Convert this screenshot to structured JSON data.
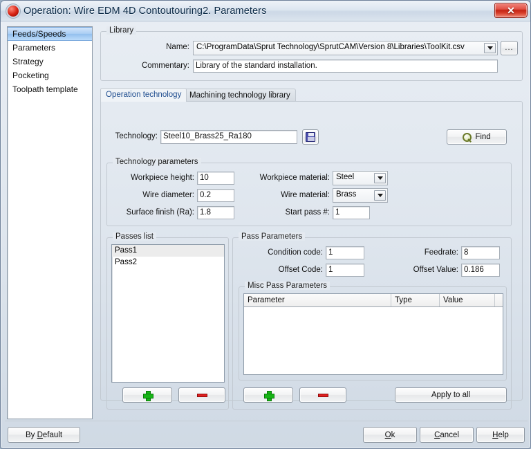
{
  "window": {
    "title": "Operation: Wire EDM 4D Contoutouring2. Parameters",
    "app_icon": "red-sphere-icon",
    "close_label": "✕"
  },
  "sidebar": {
    "items": [
      {
        "label": "Feeds/Speeds",
        "selected": true
      },
      {
        "label": "Parameters",
        "selected": false
      },
      {
        "label": "Strategy",
        "selected": false
      },
      {
        "label": "Pocketing",
        "selected": false
      },
      {
        "label": "Toolpath template",
        "selected": false
      }
    ]
  },
  "library": {
    "group_label": "Library",
    "name_label": "Name:",
    "name_value": "C:\\ProgramData\\Sprut Technology\\SprutCAM\\Version 8\\Libraries\\ToolKit.csv",
    "browse_label": "...",
    "commentary_label": "Commentary:",
    "commentary_value": "Library of the standard installation."
  },
  "tabs": [
    {
      "label": "Operation technology",
      "active": true
    },
    {
      "label": "Machining technology library",
      "active": false
    }
  ],
  "technology": {
    "label": "Technology:",
    "value": "Steel10_Brass25_Ra180",
    "save_icon": "floppy-save-icon",
    "find_label": "Find",
    "find_icon": "magnifier-icon"
  },
  "technology_parameters": {
    "group_label": "Technology parameters",
    "fields": [
      {
        "label": "Workpiece height:",
        "value": "10",
        "type": "text"
      },
      {
        "label": "Wire diameter:",
        "value": "0.2",
        "type": "text"
      },
      {
        "label": "Surface finish (Ra):",
        "value": "1.8",
        "type": "text"
      },
      {
        "label": "Workpiece material:",
        "value": "Steel",
        "type": "combo"
      },
      {
        "label": "Wire material:",
        "value": "Brass",
        "type": "combo"
      },
      {
        "label": "Start pass #:",
        "value": "1",
        "type": "text"
      }
    ]
  },
  "passes_list": {
    "group_label": "Passes list",
    "items": [
      {
        "label": "Pass1",
        "selected": true
      },
      {
        "label": "Pass2",
        "selected": false
      }
    ],
    "add_icon": "plus-icon",
    "remove_icon": "minus-icon"
  },
  "pass_parameters": {
    "group_label": "Pass Parameters",
    "fields": [
      {
        "label": "Condition code:",
        "value": "1"
      },
      {
        "label": "Offset Code:",
        "value": "1"
      },
      {
        "label": "Feedrate:",
        "value": "8"
      },
      {
        "label": "Offset Value:",
        "value": "0.186"
      }
    ],
    "misc": {
      "group_label": "Misc Pass Parameters",
      "columns": [
        "Parameter",
        "Type",
        "Value",
        ""
      ],
      "rows": []
    },
    "add_icon": "plus-icon",
    "remove_icon": "minus-icon",
    "apply_all_label": "Apply to all"
  },
  "footer": {
    "by_default": {
      "pre": "By ",
      "accel": "D",
      "post": "efault"
    },
    "ok": {
      "pre": "",
      "accel": "O",
      "post": "k"
    },
    "cancel": {
      "pre": "",
      "accel": "C",
      "post": "ancel"
    },
    "help": {
      "pre": "",
      "accel": "H",
      "post": "elp"
    }
  },
  "colors": {
    "selection_blue": "#a9cdf3",
    "tab_active_text": "#1f4d8f",
    "plus_green": "#16b516",
    "minus_red": "#e02020",
    "close_red": "#c32414"
  }
}
